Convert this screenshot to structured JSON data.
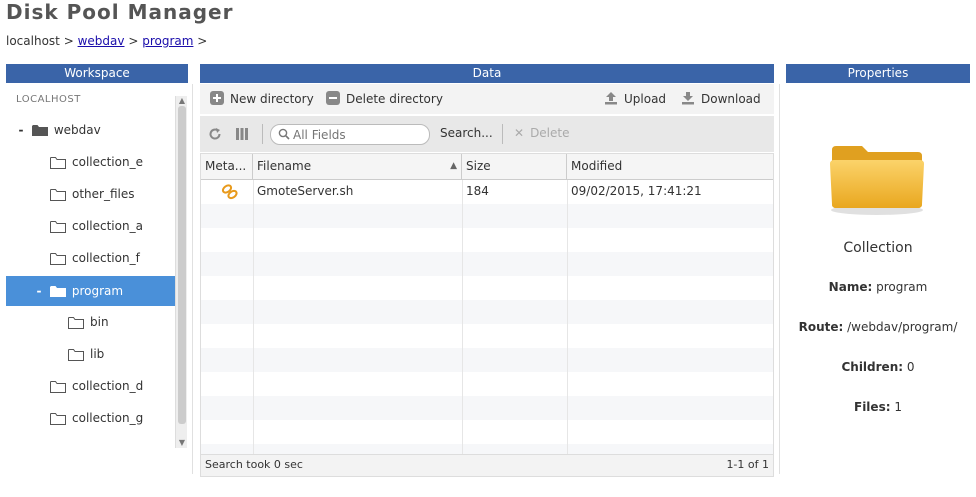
{
  "app_title": "Disk Pool Manager",
  "breadcrumb": {
    "root": "localhost",
    "sep1": ">",
    "item1": "webdav",
    "sep2": ">",
    "item2": "program",
    "sep3": ">"
  },
  "panels": {
    "workspace": "Workspace",
    "data": "Data",
    "properties": "Properties"
  },
  "workspace": {
    "root_label": "LOCALHOST",
    "items": [
      {
        "label": "webdav",
        "toggle": "-"
      },
      {
        "label": "collection_e"
      },
      {
        "label": "other_files"
      },
      {
        "label": "collection_a"
      },
      {
        "label": "collection_f"
      },
      {
        "label": "program",
        "toggle": "-"
      },
      {
        "label": "bin"
      },
      {
        "label": "lib"
      },
      {
        "label": "collection_d"
      },
      {
        "label": "collection_g"
      }
    ]
  },
  "data_toolbar": {
    "new_directory": "New directory",
    "delete_directory": "Delete directory",
    "upload": "Upload",
    "download": "Download",
    "search_placeholder": "All Fields",
    "search_button": "Search...",
    "delete": "Delete"
  },
  "grid": {
    "columns": [
      "Meta...",
      "Filename",
      "Size",
      "Modified"
    ],
    "rows": [
      {
        "filename": "GmoteServer.sh",
        "size": "184",
        "modified": "09/02/2015, 17:41:21"
      }
    ],
    "status_left": "Search took 0 sec",
    "status_right": "1-1 of 1"
  },
  "properties": {
    "type": "Collection",
    "name_label": "Name:",
    "name_value": "program",
    "route_label": "Route:",
    "route_value": "/webdav/program/",
    "children_label": "Children:",
    "children_value": "0",
    "files_label": "Files:",
    "files_value": "1"
  },
  "colors": {
    "header_blue": "#3a64a8",
    "selected": "#4a90d9",
    "folder": "#f2b632"
  }
}
